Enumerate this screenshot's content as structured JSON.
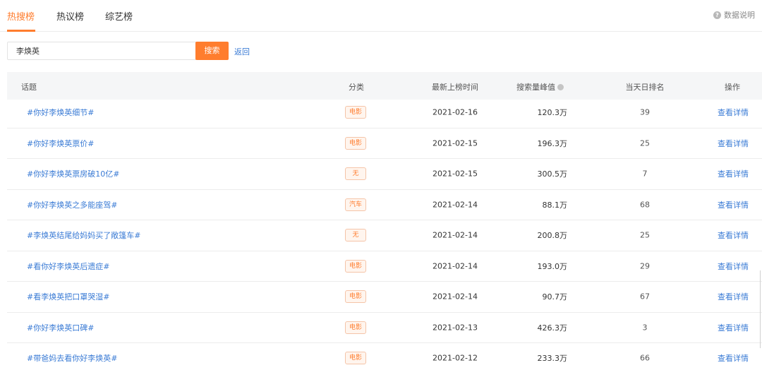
{
  "tabs": [
    {
      "label": "热搜榜",
      "active": true
    },
    {
      "label": "热议榜",
      "active": false
    },
    {
      "label": "综艺榜",
      "active": false
    }
  ],
  "help": {
    "label": "数据说明"
  },
  "search": {
    "value": "李焕英",
    "button_label": "搜索",
    "back_label": "返回"
  },
  "table": {
    "headers": {
      "topic": "话题",
      "category": "分类",
      "latest_time": "最新上榜时间",
      "peak": "搜索量峰值",
      "rank": "当天日排名",
      "action": "操作"
    },
    "rows": [
      {
        "topic": "#你好李焕英细节#",
        "category": "电影",
        "date": "2021-02-16",
        "peak": "120.3万",
        "rank": "39",
        "action": "查看详情"
      },
      {
        "topic": "#你好李焕英票价#",
        "category": "电影",
        "date": "2021-02-15",
        "peak": "196.3万",
        "rank": "25",
        "action": "查看详情"
      },
      {
        "topic": "#你好李焕英票房破10亿#",
        "category": "无",
        "date": "2021-02-15",
        "peak": "300.5万",
        "rank": "7",
        "action": "查看详情"
      },
      {
        "topic": "#你好李焕英之多能座驾#",
        "category": "汽车",
        "date": "2021-02-14",
        "peak": "88.1万",
        "rank": "68",
        "action": "查看详情"
      },
      {
        "topic": "#李焕英结尾给妈妈买了敞篷车#",
        "category": "无",
        "date": "2021-02-14",
        "peak": "200.8万",
        "rank": "25",
        "action": "查看详情"
      },
      {
        "topic": "#看你好李焕英后遗症#",
        "category": "电影",
        "date": "2021-02-14",
        "peak": "193.0万",
        "rank": "29",
        "action": "查看详情"
      },
      {
        "topic": "#看李焕英把口罩哭湿#",
        "category": "电影",
        "date": "2021-02-14",
        "peak": "90.7万",
        "rank": "67",
        "action": "查看详情"
      },
      {
        "topic": "#你好李焕英口碑#",
        "category": "电影",
        "date": "2021-02-13",
        "peak": "426.3万",
        "rank": "3",
        "action": "查看详情"
      },
      {
        "topic": "#带爸妈去看你好李焕英#",
        "category": "电影",
        "date": "2021-02-12",
        "peak": "233.3万",
        "rank": "66",
        "action": "查看详情"
      }
    ]
  },
  "colors": {
    "accent": "#ff7d2e",
    "link": "#3a7bd5"
  }
}
